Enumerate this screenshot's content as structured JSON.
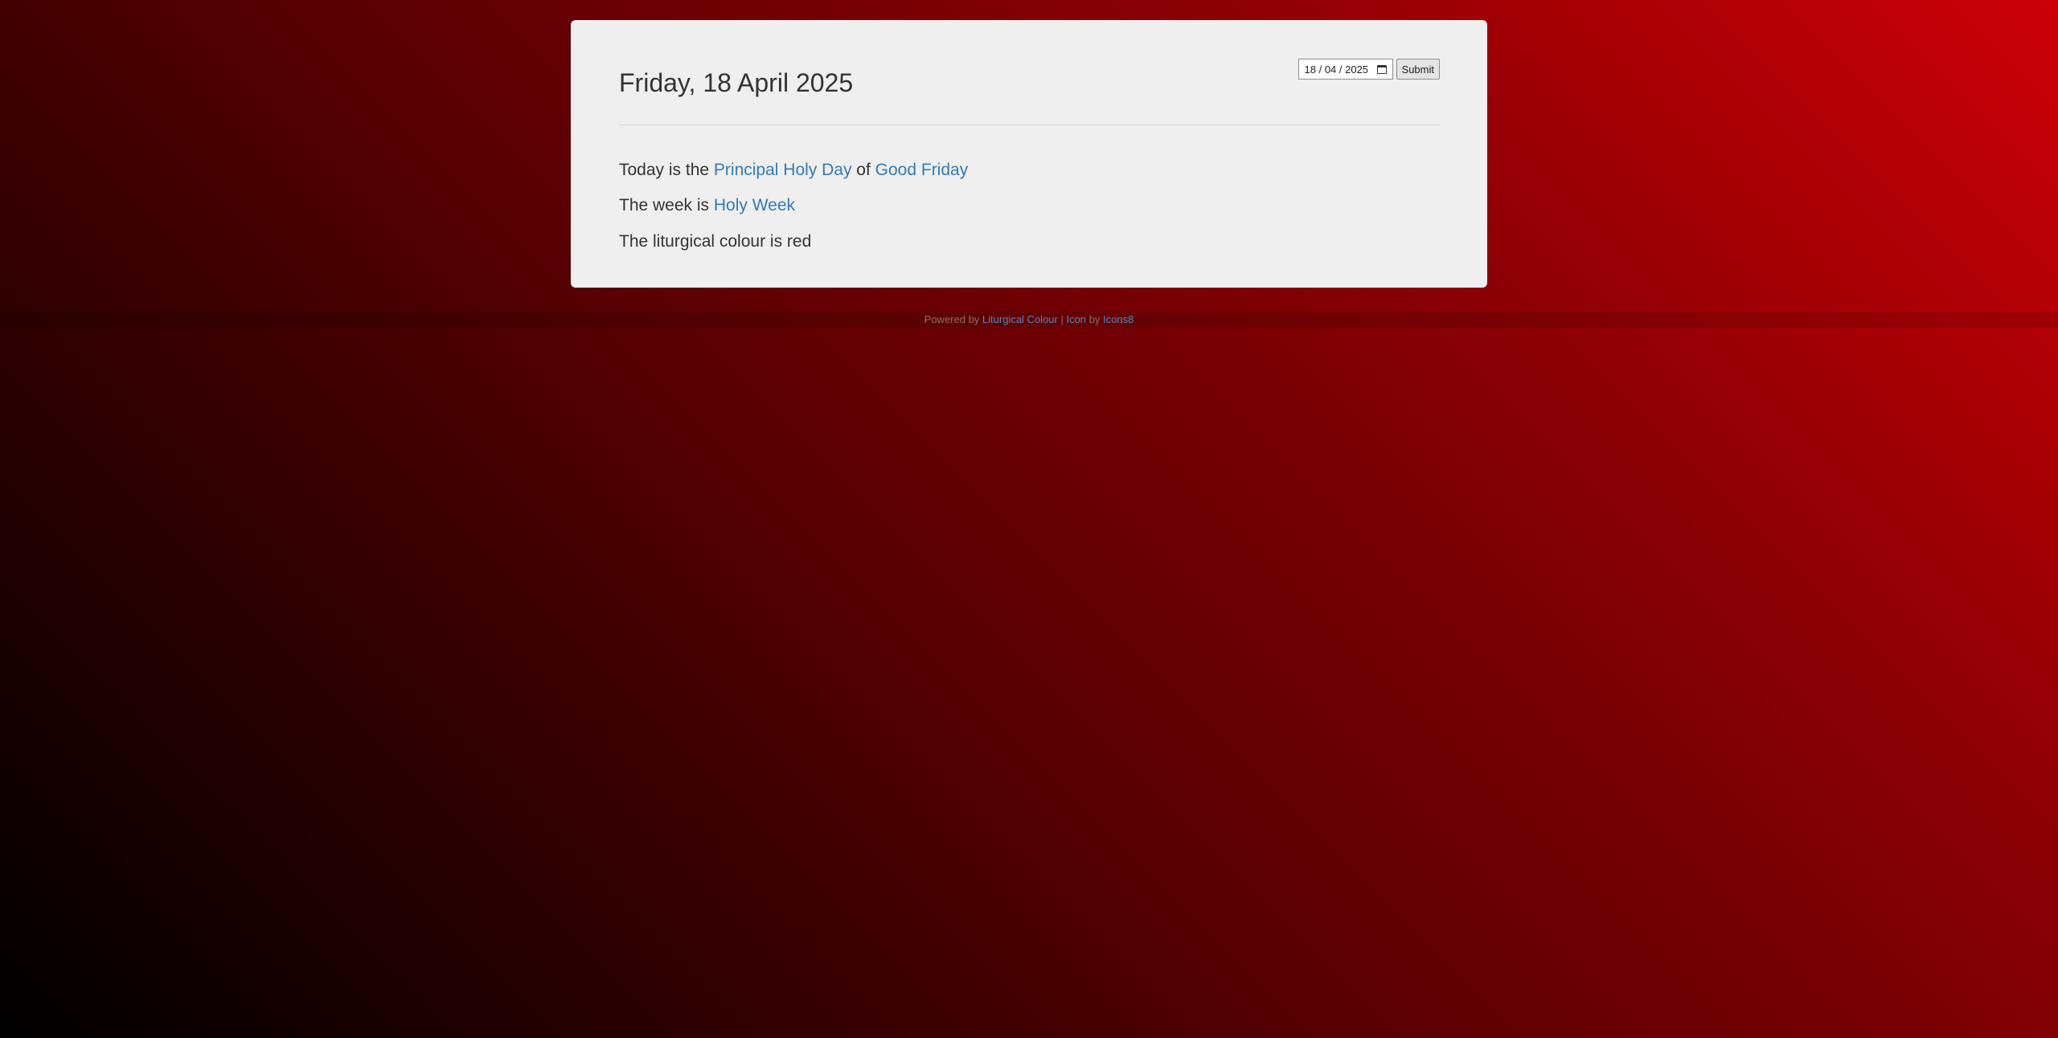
{
  "date_picker": {
    "value": "18 / 04 / 2025",
    "submit_label": "Submit"
  },
  "heading": {
    "title": "Friday, 18 April 2025"
  },
  "today_line": {
    "prefix": "Today is the ",
    "rank_link": "Principal Holy Day",
    "middle": " of ",
    "observance_link": "Good Friday"
  },
  "week_line": {
    "prefix": "The week is ",
    "week_link": "Holy Week"
  },
  "colour_line": {
    "text": "The liturgical colour is red"
  },
  "footer": {
    "powered_by": "Powered by ",
    "liturgical_colour_link": "Liturgical Colour",
    "separator": " | ",
    "icon_link": "Icon",
    "by": " by ",
    "icons8_link": "Icons8"
  },
  "colors": {
    "background_top_right": "#cc0008",
    "background_bottom_left": "#000000",
    "card_background": "#efefef",
    "link": "#337ab7",
    "text": "#333333"
  },
  "icons": {
    "calendar": "calendar-icon"
  }
}
